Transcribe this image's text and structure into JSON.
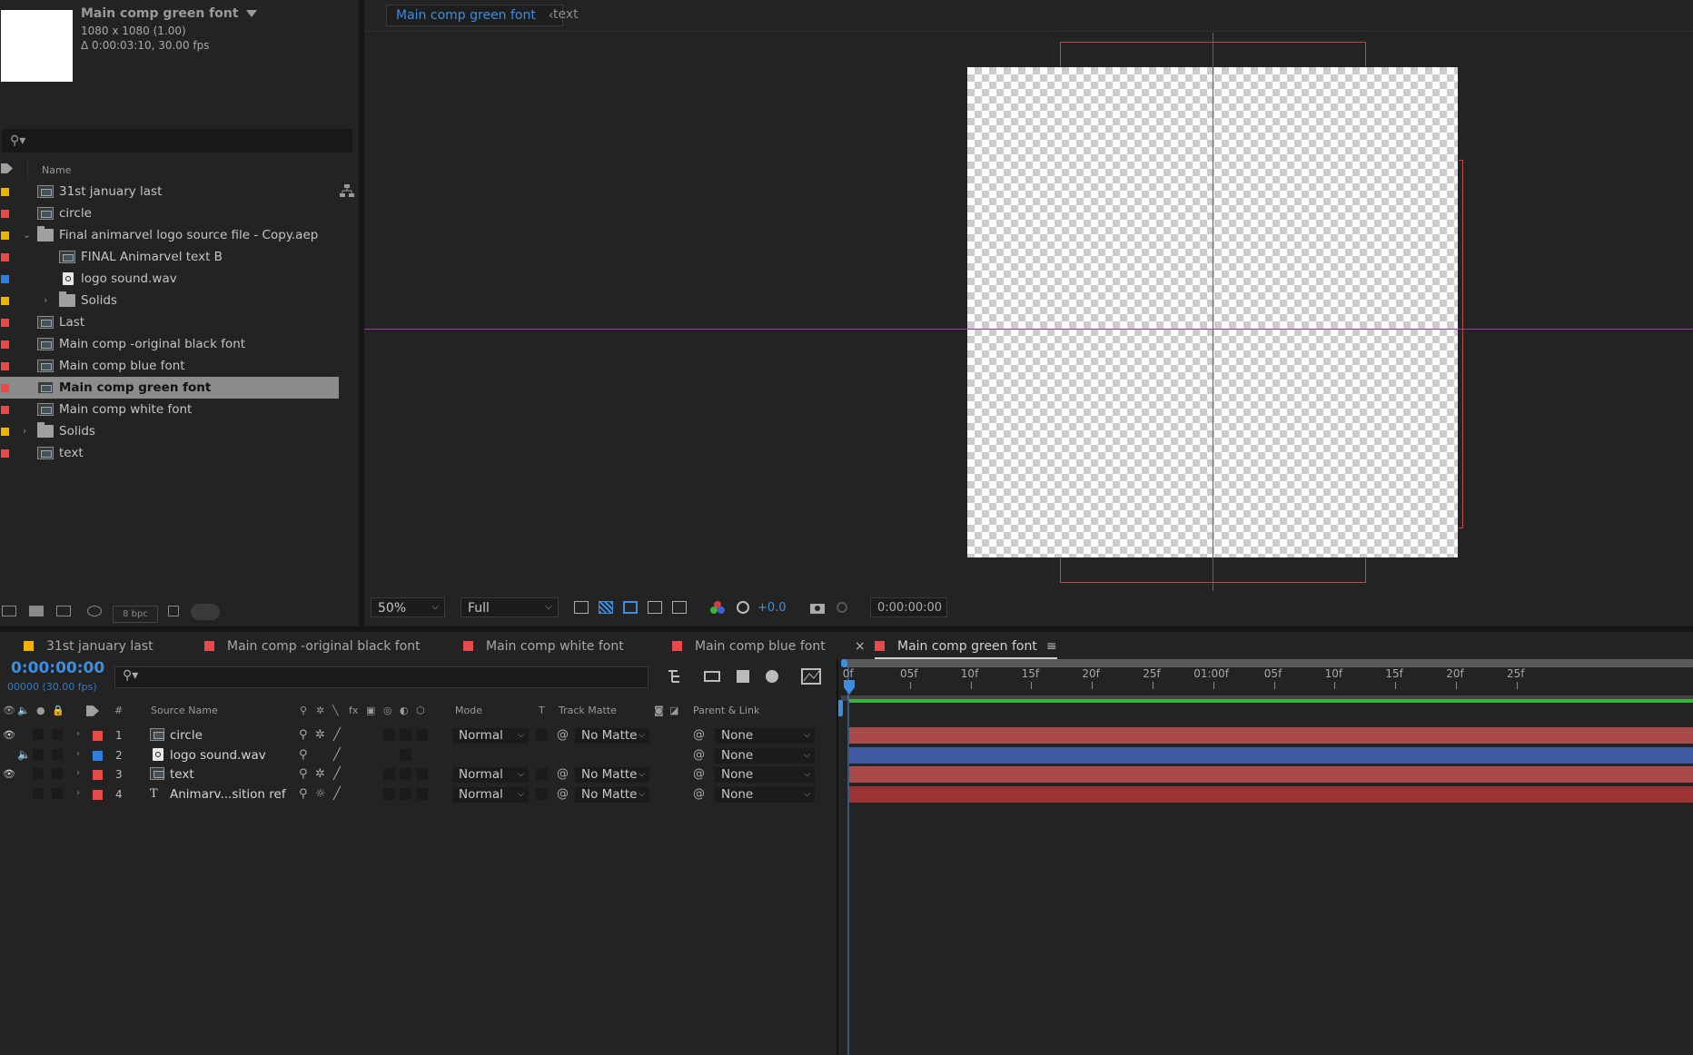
{
  "project": {
    "comp_title": "Main comp green font",
    "comp_size": "1080 x 1080 (1.00)",
    "comp_duration": "Δ 0:00:03:10, 30.00 fps",
    "search_placeholder": "",
    "column_name": "Name",
    "bpc": "8 bpc",
    "items": [
      {
        "label": "31st january last",
        "type": "comp",
        "color": "#f0b400",
        "indent": 0
      },
      {
        "label": "circle",
        "type": "comp",
        "color": "#e84a4a",
        "indent": 0
      },
      {
        "label": "Final animarvel logo source file - Copy.aep",
        "type": "folder",
        "color": "#f0b400",
        "indent": 0,
        "expanded": true
      },
      {
        "label": "FINAL Animarvel text B",
        "type": "comp",
        "color": "#e84a4a",
        "indent": 1
      },
      {
        "label": "logo sound.wav",
        "type": "audio",
        "color": "#2f7fe0",
        "indent": 1
      },
      {
        "label": "Solids",
        "type": "folder",
        "color": "#f0b400",
        "indent": 1,
        "expanded": false
      },
      {
        "label": "Last",
        "type": "comp",
        "color": "#e84a4a",
        "indent": 0
      },
      {
        "label": "Main comp -original black font",
        "type": "comp",
        "color": "#e84a4a",
        "indent": 0
      },
      {
        "label": "Main comp blue font",
        "type": "comp",
        "color": "#e84a4a",
        "indent": 0
      },
      {
        "label": "Main comp green font",
        "type": "comp",
        "color": "#e84a4a",
        "indent": 0,
        "selected": true
      },
      {
        "label": "Main comp white font",
        "type": "comp",
        "color": "#e84a4a",
        "indent": 0
      },
      {
        "label": "Solids",
        "type": "folder",
        "color": "#f0b400",
        "indent": 0,
        "expanded": false
      },
      {
        "label": "text",
        "type": "comp",
        "color": "#e84a4a",
        "indent": 0
      }
    ]
  },
  "viewer": {
    "active_tab": "Main comp green font",
    "inactive_tab": "text",
    "zoom": "50%",
    "resolution": "Full",
    "exposure": "+0.0",
    "timecode": "0:00:00:00"
  },
  "timeline": {
    "tabs": [
      {
        "label": "31st january last",
        "color": "#f0b400"
      },
      {
        "label": "Main comp -original black font",
        "color": "#e84a4a"
      },
      {
        "label": "Main comp white font",
        "color": "#e84a4a"
      },
      {
        "label": "Main comp blue font",
        "color": "#e84a4a"
      },
      {
        "label": "Main comp green font",
        "color": "#e84a4a",
        "active": true
      }
    ],
    "timecode": "0:00:00:00",
    "frames": "00000 (30.00 fps)",
    "headers": {
      "number": "#",
      "source_name": "Source Name",
      "mode": "Mode",
      "t": "T",
      "track_matte": "Track Matte",
      "parent": "Parent & Link"
    },
    "ruler_labels": [
      "0f",
      "05f",
      "10f",
      "15f",
      "20f",
      "25f",
      "01:00f",
      "05f",
      "10f",
      "15f",
      "20f",
      "25f"
    ],
    "layers": [
      {
        "num": "1",
        "name": "circle",
        "type": "comp",
        "color": "#e84a4a",
        "video": true,
        "audio": false,
        "mode": "Normal",
        "matte": "No Matte",
        "parent": "None",
        "bar_color": "#a84a4a"
      },
      {
        "num": "2",
        "name": "logo sound.wav",
        "type": "audio",
        "color": "#2f7fe0",
        "video": false,
        "audio": true,
        "mode": "",
        "matte": "",
        "parent": "None",
        "bar_color": "#3e5aa0"
      },
      {
        "num": "3",
        "name": "text",
        "type": "comp",
        "color": "#e84a4a",
        "video": true,
        "audio": false,
        "mode": "Normal",
        "matte": "No Matte",
        "parent": "None",
        "bar_color": "#a84a4a"
      },
      {
        "num": "4",
        "name": "Animarv...sition ref",
        "type": "text",
        "color": "#e84a4a",
        "video": false,
        "audio": false,
        "mode": "Normal",
        "matte": "No Matte",
        "parent": "None",
        "bar_color": "#9a3434"
      }
    ]
  }
}
